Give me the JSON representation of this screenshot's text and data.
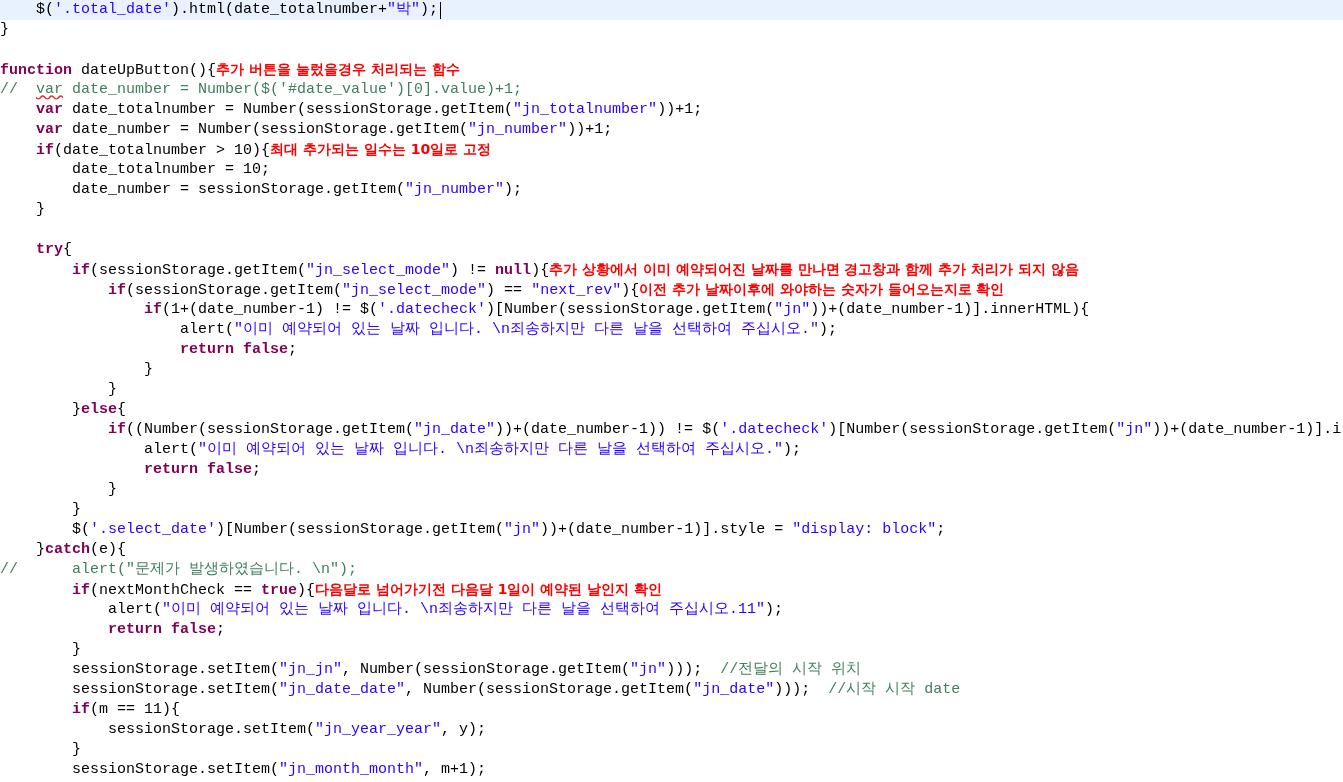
{
  "editor": {
    "lines": [
      {
        "current": true,
        "tokens": [
          {
            "kind": "plain",
            "text": "    $("
          },
          {
            "kind": "string",
            "text": "'.total_date'"
          },
          {
            "kind": "plain",
            "text": ").html(date_totalnumber+"
          },
          {
            "kind": "string",
            "text": "\"박\""
          },
          {
            "kind": "plain",
            "text": ");"
          }
        ]
      },
      {
        "current": false,
        "tokens": [
          {
            "kind": "plain",
            "text": "}"
          }
        ]
      },
      {
        "current": false
      },
      {
        "current": false,
        "tokens": [
          {
            "kind": "keyword",
            "text": "function"
          },
          {
            "kind": "plain",
            "text": " dateUpButton(){"
          },
          {
            "kind": "note",
            "text": "추가 버튼을 눌렀을경우 처리되는 함수"
          }
        ]
      },
      {
        "current": false,
        "tokens": [
          {
            "kind": "comment",
            "text": "//  "
          },
          {
            "kind": "comment",
            "text": "var",
            "squiggle": true
          },
          {
            "kind": "comment",
            "text": " date_number = Number($('#date_value')[0].value)+1;"
          }
        ]
      },
      {
        "current": false,
        "tokens": [
          {
            "kind": "keyword",
            "text": "    var"
          },
          {
            "kind": "plain",
            "text": " date_totalnumber = Number(sessionStorage.getItem("
          },
          {
            "kind": "string",
            "text": "\"jn_totalnumber\""
          },
          {
            "kind": "plain",
            "text": "))+1;"
          }
        ]
      },
      {
        "current": false,
        "tokens": [
          {
            "kind": "keyword",
            "text": "    var"
          },
          {
            "kind": "plain",
            "text": " date_number = Number(sessionStorage.getItem("
          },
          {
            "kind": "string",
            "text": "\"jn_number\""
          },
          {
            "kind": "plain",
            "text": "))+1;"
          }
        ]
      },
      {
        "current": false,
        "tokens": [
          {
            "kind": "keyword",
            "text": "    if"
          },
          {
            "kind": "plain",
            "text": "(date_totalnumber > 10){"
          },
          {
            "kind": "note",
            "text": "최대 추가되는 일수는 10일로 고정"
          }
        ]
      },
      {
        "current": false,
        "tokens": [
          {
            "kind": "plain",
            "text": "        date_totalnumber = 10;"
          }
        ]
      },
      {
        "current": false,
        "tokens": [
          {
            "kind": "plain",
            "text": "        date_number = sessionStorage.getItem("
          },
          {
            "kind": "string",
            "text": "\"jn_number\""
          },
          {
            "kind": "plain",
            "text": ");"
          }
        ]
      },
      {
        "current": false,
        "tokens": [
          {
            "kind": "plain",
            "text": "    }"
          }
        ]
      },
      {
        "current": false
      },
      {
        "current": false,
        "tokens": [
          {
            "kind": "keyword",
            "text": "    try"
          },
          {
            "kind": "plain",
            "text": "{"
          }
        ]
      },
      {
        "current": false,
        "tokens": [
          {
            "kind": "keyword",
            "text": "        if"
          },
          {
            "kind": "plain",
            "text": "(sessionStorage.getItem("
          },
          {
            "kind": "string",
            "text": "\"jn_select_mode\""
          },
          {
            "kind": "plain",
            "text": ") != "
          },
          {
            "kind": "keyword",
            "text": "null"
          },
          {
            "kind": "plain",
            "text": "){"
          },
          {
            "kind": "note",
            "text": "추가 상황에서 이미 예약되어진 날짜를 만나면 경고창과 함께 추가 처리가 되지 않음"
          }
        ]
      },
      {
        "current": false,
        "tokens": [
          {
            "kind": "keyword",
            "text": "            if"
          },
          {
            "kind": "plain",
            "text": "(sessionStorage.getItem("
          },
          {
            "kind": "string",
            "text": "\"jn_select_mode\""
          },
          {
            "kind": "plain",
            "text": ") == "
          },
          {
            "kind": "string",
            "text": "\"next_rev\""
          },
          {
            "kind": "plain",
            "text": "){"
          },
          {
            "kind": "note",
            "text": "이전 추가 날짜이후에 와야하는 숫자가 들어오는지로 확인"
          }
        ]
      },
      {
        "current": false,
        "tokens": [
          {
            "kind": "keyword",
            "text": "                if"
          },
          {
            "kind": "plain",
            "text": "(1+(date_number-1) != $("
          },
          {
            "kind": "string",
            "text": "'.datecheck'"
          },
          {
            "kind": "plain",
            "text": ")[Number(sessionStorage.getItem("
          },
          {
            "kind": "string",
            "text": "\"jn\""
          },
          {
            "kind": "plain",
            "text": "))+(date_number-1)].innerHTML){"
          }
        ]
      },
      {
        "current": false,
        "tokens": [
          {
            "kind": "plain",
            "text": "                    alert("
          },
          {
            "kind": "string",
            "text": "\"이미 예약되어 있는 날짜 입니다. \\n죄송하지만 다른 날을 선택하여 주십시오.\""
          },
          {
            "kind": "plain",
            "text": ");"
          }
        ]
      },
      {
        "current": false,
        "tokens": [
          {
            "kind": "keyword",
            "text": "                    return false"
          },
          {
            "kind": "plain",
            "text": ";"
          }
        ]
      },
      {
        "current": false,
        "tokens": [
          {
            "kind": "plain",
            "text": "                }"
          }
        ]
      },
      {
        "current": false,
        "tokens": [
          {
            "kind": "plain",
            "text": "            }"
          }
        ]
      },
      {
        "current": false,
        "tokens": [
          {
            "kind": "plain",
            "text": "        }"
          },
          {
            "kind": "keyword",
            "text": "else"
          },
          {
            "kind": "plain",
            "text": "{"
          }
        ]
      },
      {
        "current": false,
        "tokens": [
          {
            "kind": "keyword",
            "text": "            if"
          },
          {
            "kind": "plain",
            "text": "((Number(sessionStorage.getItem("
          },
          {
            "kind": "string",
            "text": "\"jn_date\""
          },
          {
            "kind": "plain",
            "text": "))+(date_number-1)) != $("
          },
          {
            "kind": "string",
            "text": "'.datecheck'"
          },
          {
            "kind": "plain",
            "text": ")[Number(sessionStorage.getItem("
          },
          {
            "kind": "string",
            "text": "\"jn\""
          },
          {
            "kind": "plain",
            "text": "))+(date_number-1)].i"
          }
        ]
      },
      {
        "current": false,
        "tokens": [
          {
            "kind": "plain",
            "text": "                alert("
          },
          {
            "kind": "string",
            "text": "\"이미 예약되어 있는 날짜 입니다. \\n죄송하지만 다른 날을 선택하여 주십시오.\""
          },
          {
            "kind": "plain",
            "text": ");"
          }
        ]
      },
      {
        "current": false,
        "tokens": [
          {
            "kind": "keyword",
            "text": "                return false"
          },
          {
            "kind": "plain",
            "text": ";"
          }
        ]
      },
      {
        "current": false,
        "tokens": [
          {
            "kind": "plain",
            "text": "            }"
          }
        ]
      },
      {
        "current": false,
        "tokens": [
          {
            "kind": "plain",
            "text": "        }"
          }
        ]
      },
      {
        "current": false,
        "tokens": [
          {
            "kind": "plain",
            "text": "        $("
          },
          {
            "kind": "string",
            "text": "'.select_date'"
          },
          {
            "kind": "plain",
            "text": ")[Number(sessionStorage.getItem("
          },
          {
            "kind": "string",
            "text": "\"jn\""
          },
          {
            "kind": "plain",
            "text": "))+(date_number-1)].style = "
          },
          {
            "kind": "string",
            "text": "\"display: block\""
          },
          {
            "kind": "plain",
            "text": ";"
          }
        ]
      },
      {
        "current": false,
        "tokens": [
          {
            "kind": "plain",
            "text": "    }"
          },
          {
            "kind": "keyword",
            "text": "catch"
          },
          {
            "kind": "plain",
            "text": "(e){"
          }
        ]
      },
      {
        "current": false,
        "tokens": [
          {
            "kind": "comment",
            "text": "//      alert(\"문제가 발생하였습니다. \\n\");"
          }
        ]
      },
      {
        "current": false,
        "tokens": [
          {
            "kind": "keyword",
            "text": "        if"
          },
          {
            "kind": "plain",
            "text": "(nextMonthCheck == "
          },
          {
            "kind": "keyword",
            "text": "true"
          },
          {
            "kind": "plain",
            "text": "){"
          },
          {
            "kind": "note",
            "text": "다음달로 넘어가기전 다음달 1일이 예약된 날인지 확인"
          }
        ]
      },
      {
        "current": false,
        "tokens": [
          {
            "kind": "plain",
            "text": "            alert("
          },
          {
            "kind": "string",
            "text": "\"이미 예약되어 있는 날짜 입니다. \\n죄송하지만 다른 날을 선택하여 주십시오.11\""
          },
          {
            "kind": "plain",
            "text": ");"
          }
        ]
      },
      {
        "current": false,
        "tokens": [
          {
            "kind": "keyword",
            "text": "            return false"
          },
          {
            "kind": "plain",
            "text": ";"
          }
        ]
      },
      {
        "current": false,
        "tokens": [
          {
            "kind": "plain",
            "text": "        }"
          }
        ]
      },
      {
        "current": false,
        "tokens": [
          {
            "kind": "plain",
            "text": "        sessionStorage.setItem("
          },
          {
            "kind": "string",
            "text": "\"jn_jn\""
          },
          {
            "kind": "plain",
            "text": ", Number(sessionStorage.getItem("
          },
          {
            "kind": "string",
            "text": "\"jn\""
          },
          {
            "kind": "plain",
            "text": ")));"
          },
          {
            "kind": "comment",
            "text": "  //전달의 시작 위치"
          }
        ]
      },
      {
        "current": false,
        "tokens": [
          {
            "kind": "plain",
            "text": "        sessionStorage.setItem("
          },
          {
            "kind": "string",
            "text": "\"jn_date_date\""
          },
          {
            "kind": "plain",
            "text": ", Number(sessionStorage.getItem("
          },
          {
            "kind": "string",
            "text": "\"jn_date\""
          },
          {
            "kind": "plain",
            "text": ")));"
          },
          {
            "kind": "comment",
            "text": "  //시작 시작 date"
          }
        ]
      },
      {
        "current": false,
        "tokens": [
          {
            "kind": "keyword",
            "text": "        if"
          },
          {
            "kind": "plain",
            "text": "(m == 11){"
          }
        ]
      },
      {
        "current": false,
        "tokens": [
          {
            "kind": "plain",
            "text": "            sessionStorage.setItem("
          },
          {
            "kind": "string",
            "text": "\"jn_year_year\""
          },
          {
            "kind": "plain",
            "text": ", y);"
          }
        ]
      },
      {
        "current": false,
        "tokens": [
          {
            "kind": "plain",
            "text": "        }"
          }
        ]
      },
      {
        "current": false,
        "tokens": [
          {
            "kind": "plain",
            "text": "        sessionStorage.setItem("
          },
          {
            "kind": "string",
            "text": "\"jn_month_month\""
          },
          {
            "kind": "plain",
            "text": ", m+1);"
          }
        ]
      }
    ]
  }
}
